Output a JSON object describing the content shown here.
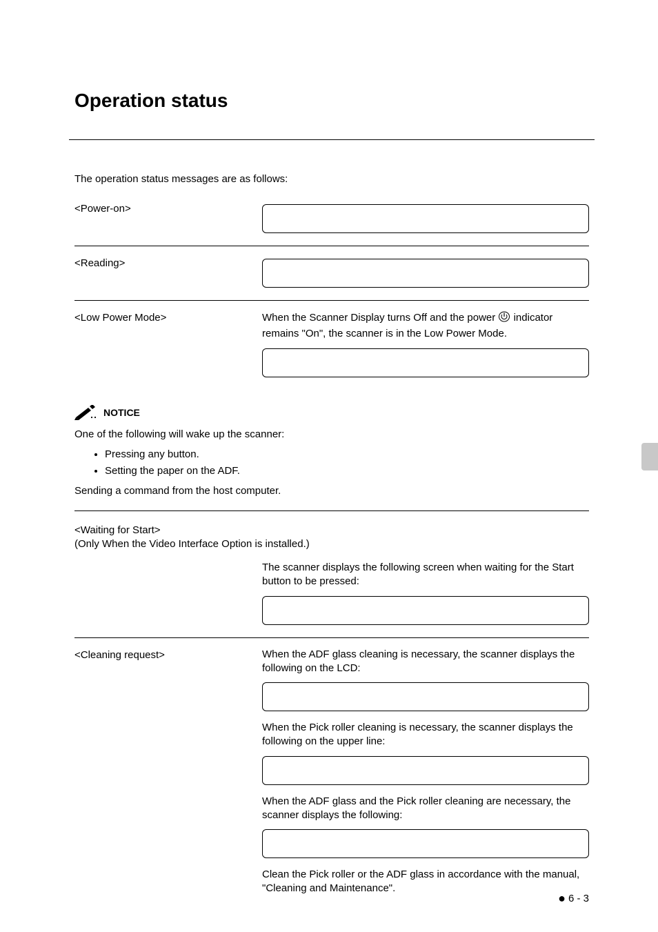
{
  "title": "Operation status",
  "intro": "The operation status messages are as follows:",
  "rows": {
    "power_on": {
      "label": "<Power-on>"
    },
    "reading": {
      "label": "<Reading>"
    },
    "low_power": {
      "label": "<Low Power Mode>",
      "desc_pre": "When the Scanner Display turns Off and the power ",
      "desc_post": " indicator remains \"On\", the scanner is in the Low Power Mode."
    }
  },
  "notice": {
    "label": "NOTICE",
    "line1": "One of the following will wake up the scanner:",
    "items": [
      "Pressing any button.",
      "Setting the paper on the ADF."
    ],
    "line2": "Sending a command from the host computer."
  },
  "waiting": {
    "head1": "<Waiting for Start>",
    "head2": "(Only When the Video Interface Option is installed.)",
    "desc": "The scanner displays the following screen when waiting for the Start button to be pressed:"
  },
  "cleaning": {
    "label": "<Cleaning request>",
    "desc1": "When the ADF glass cleaning is necessary, the scanner displays the following on the LCD:",
    "desc2": "When the Pick roller cleaning is necessary, the scanner displays the following on the upper line:",
    "desc3": "When the ADF glass and the Pick roller cleaning are necessary, the scanner displays the following:",
    "desc4": "Clean the Pick roller or the ADF glass in accordance with the manual, \"Cleaning and Maintenance\"."
  },
  "pagenum": "6 - 3"
}
